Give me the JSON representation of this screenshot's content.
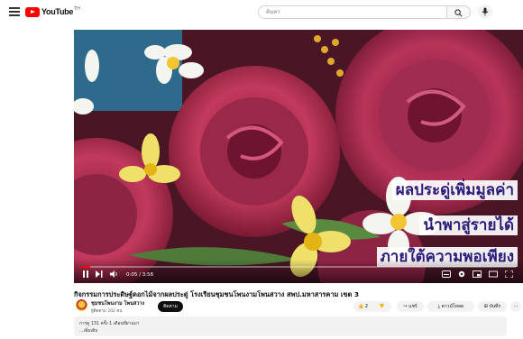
{
  "header": {
    "logo_text": "YouTube",
    "logo_tm": "TH",
    "search_placeholder": "ค้นหา"
  },
  "player": {
    "captions": [
      "ผลประดู่เพิ่มมูลค่า",
      "นำพาสู่รายได้",
      "ภายใต้ความพอเพียง"
    ],
    "time": "0:05 / 3:58",
    "progress": 0.02
  },
  "video": {
    "title": "กิจกรรมการประดิษฐ์ดอกไม้จากผลประดู่ โรงเรียนชุมชนโพนงามโพนสวาง สพป.มหาสารคาม เขต 3",
    "channel": "ชุมชนโพนงาม โพนสวาง",
    "subscribers": "ผู้ติดตาม 202 คน",
    "subscribe_label": "ติดตาม",
    "like_count": "2",
    "share_label": "แชร์",
    "download_label": "ดาวน์โหลด",
    "save_label": "บันทึก",
    "views_line": "การดู 131 ครั้ง 1 เดือนที่ผ่านมา",
    "more_label": "...เพิ่มเติม"
  }
}
